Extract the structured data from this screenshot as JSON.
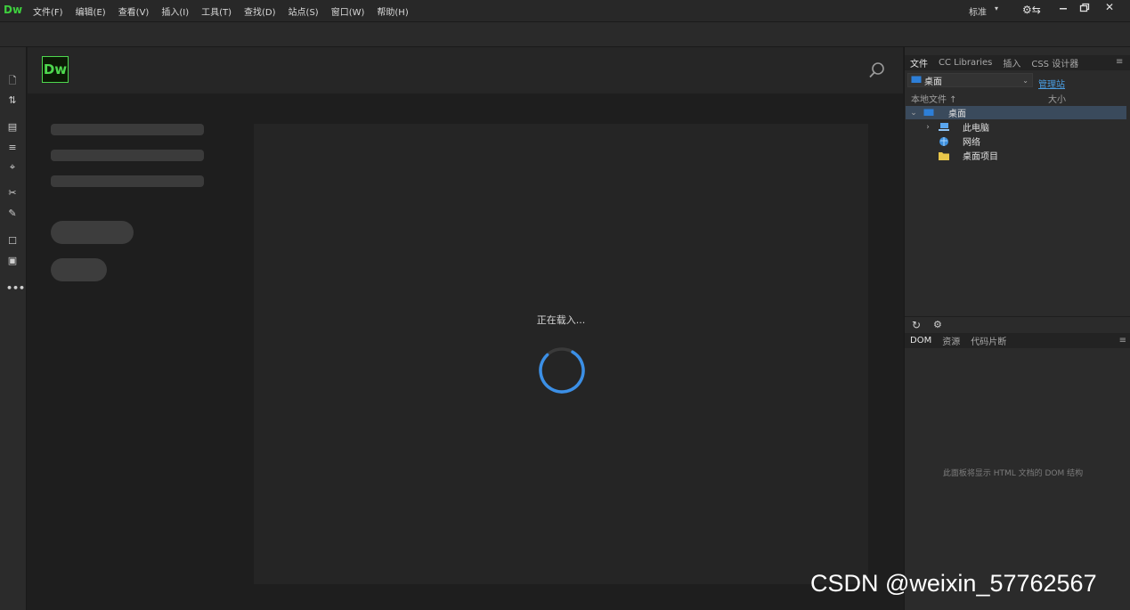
{
  "app": {
    "logo_text": "Dw",
    "menus": [
      "文件(F)",
      "编辑(E)",
      "查看(V)",
      "插入(I)",
      "工具(T)",
      "查找(D)",
      "站点(S)",
      "窗口(W)",
      "帮助(H)"
    ],
    "workspace": "标准",
    "accent_color": "#4ed84e"
  },
  "start_screen": {
    "logo_text": "Dw",
    "loading_text": "正在载入..."
  },
  "files_panel": {
    "tabs": [
      "文件",
      "CC Libraries",
      "插入",
      "CSS 设计器"
    ],
    "site_select": "桌面",
    "manage_sites": "管理站",
    "columns": {
      "local": "本地文件",
      "size": "大小"
    },
    "tree": [
      {
        "label": "桌面",
        "icon": "desktop-icon",
        "expanded": true,
        "selected": true
      },
      {
        "label": "此电脑",
        "icon": "computer-icon",
        "expanded": false
      },
      {
        "label": "网络",
        "icon": "network-icon"
      },
      {
        "label": "桌面项目",
        "icon": "folder-icon"
      }
    ]
  },
  "dom_panel": {
    "tabs": [
      "DOM",
      "资源",
      "代码片断"
    ],
    "placeholder": "此面板将显示 HTML 文档的 DOM 结构"
  },
  "watermark": "CSDN @weixin_57762567"
}
